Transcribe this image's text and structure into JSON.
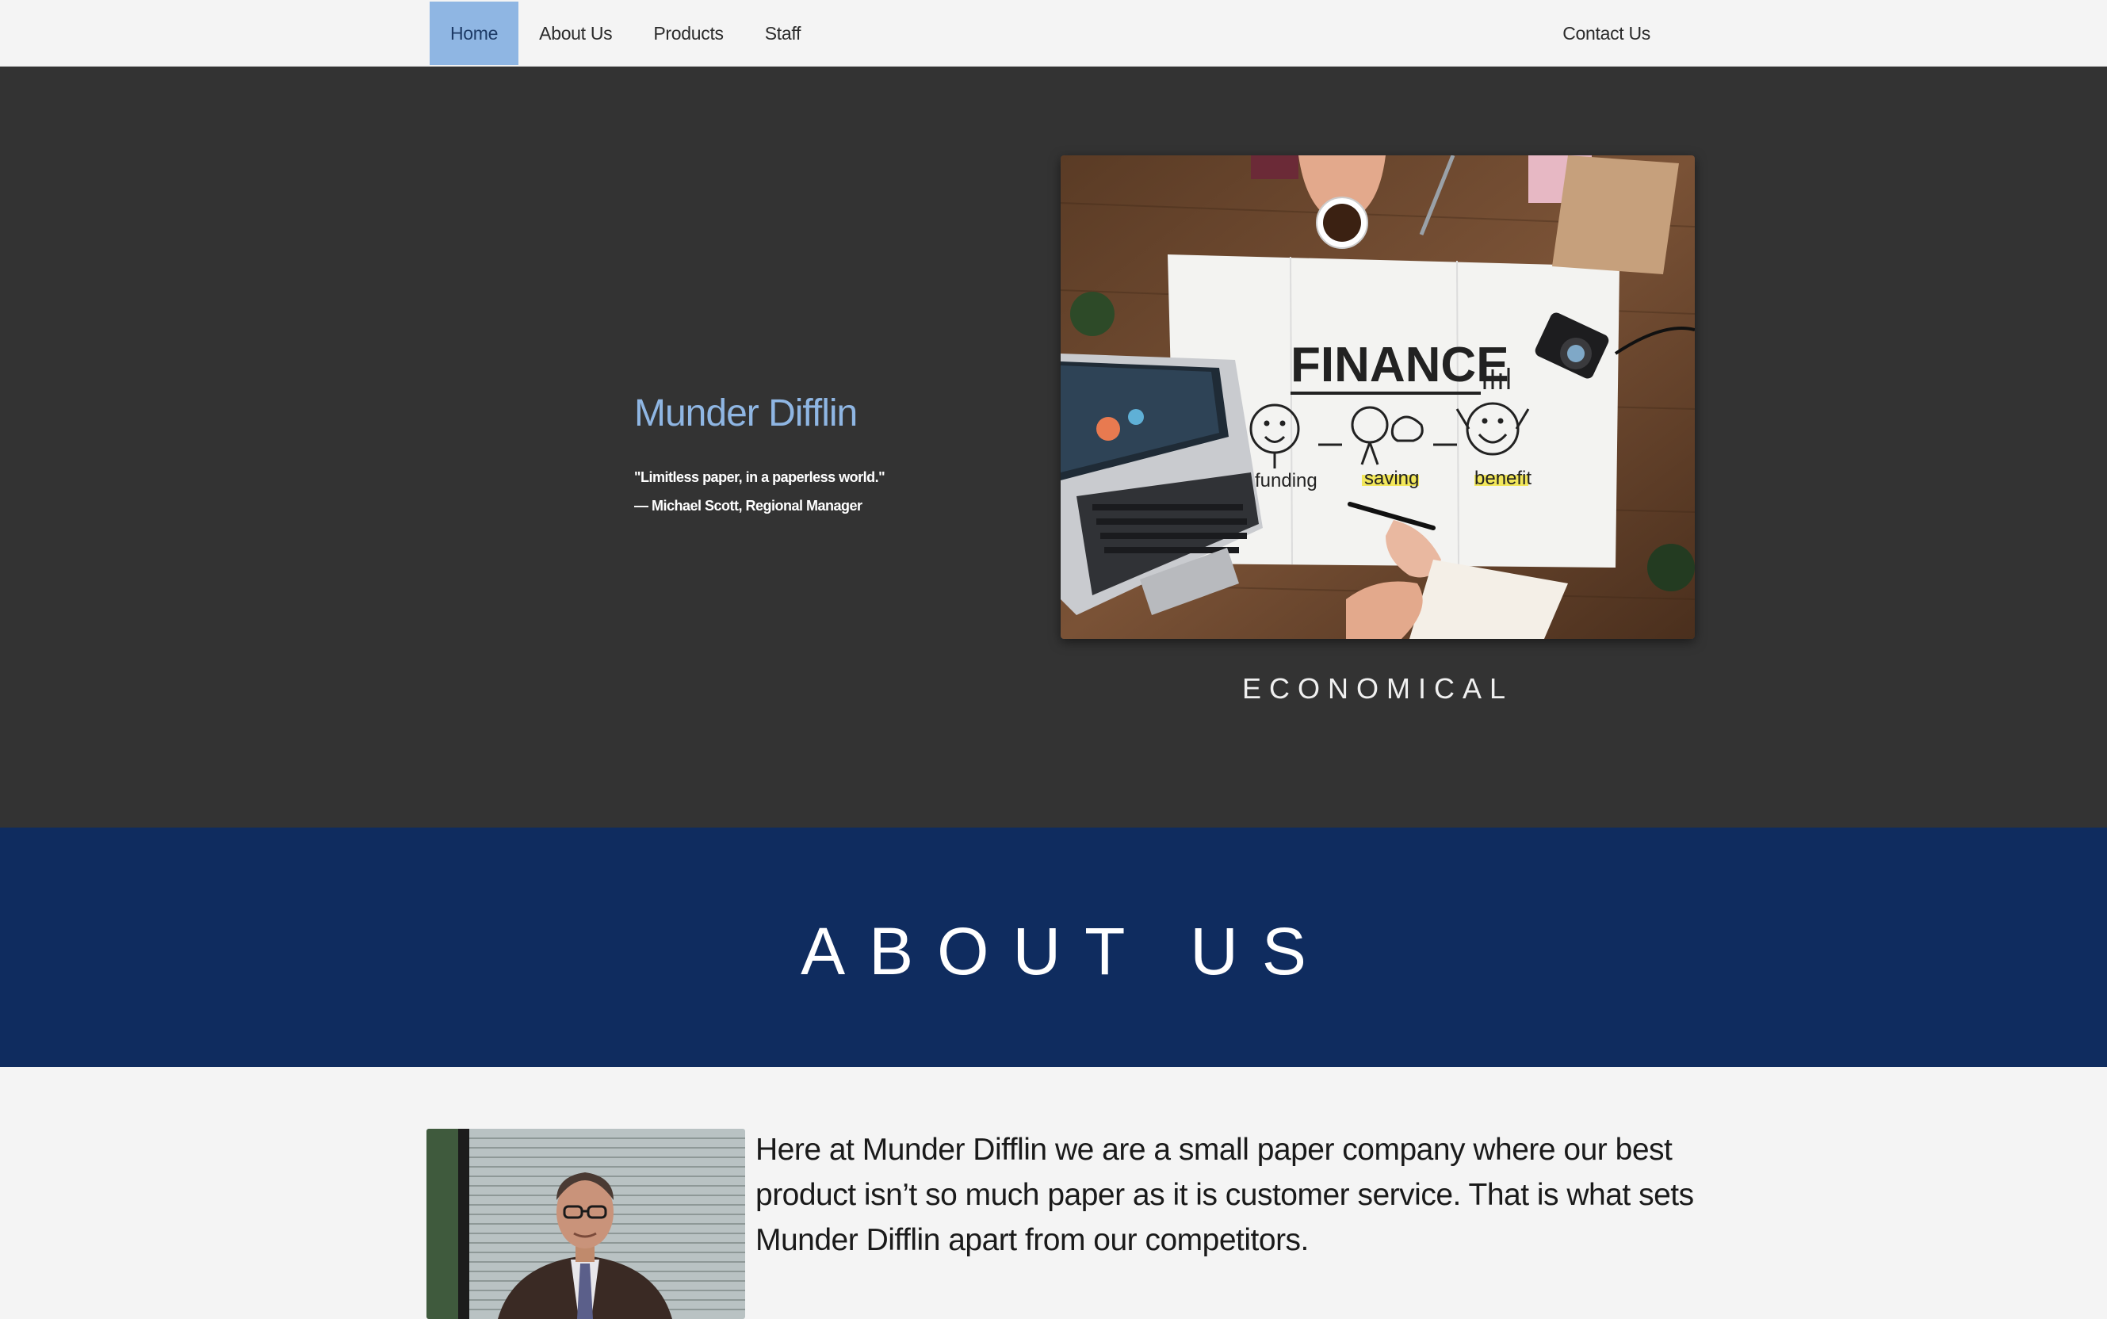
{
  "nav": {
    "items": [
      {
        "label": "Home",
        "active": true
      },
      {
        "label": "About Us",
        "active": false
      },
      {
        "label": "Products",
        "active": false
      },
      {
        "label": "Staff",
        "active": false
      }
    ],
    "contact_label": "Contact Us"
  },
  "hero": {
    "brand": "Munder Difflin",
    "quote": "\"Limitless paper, in a paperless world.\"",
    "attribution": "— Michael Scott, Regional Manager",
    "image_text": {
      "heading": "FINANCE",
      "labels": [
        "funding",
        "saving",
        "benefit"
      ]
    },
    "caption": "ECONOMICAL"
  },
  "about": {
    "title": "ABOUT US",
    "text": "Here at Munder Difflin we are a small paper company where our best product isn’t so much paper as it is customer service. That is what sets Munder Difflin apart from our competitors."
  },
  "colors": {
    "nav_bg": "#f4f4f4",
    "nav_active": "#8fb6e3",
    "hero_bg": "#333333",
    "brand_blue": "#8fb6e3",
    "about_banner": "#0f2c5f"
  }
}
